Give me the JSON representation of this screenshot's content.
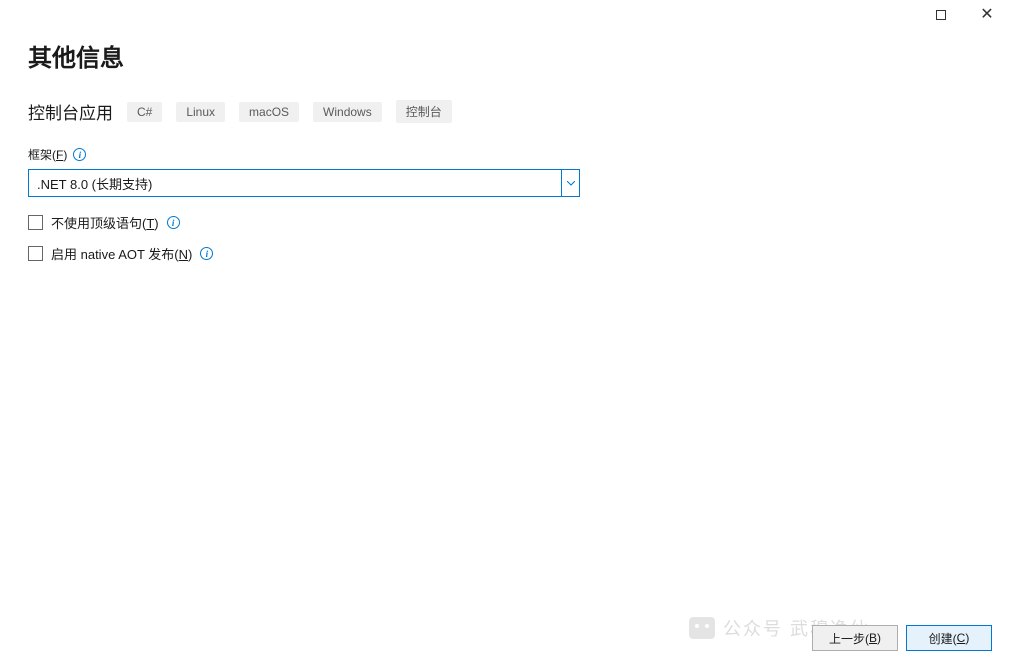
{
  "titlebar": {
    "maximize_name": "maximize",
    "close_name": "close"
  },
  "page": {
    "title": "其他信息",
    "subtitle": "控制台应用",
    "tags": [
      "C#",
      "Linux",
      "macOS",
      "Windows",
      "控制台"
    ]
  },
  "framework": {
    "label_prefix": "框架(",
    "label_hotkey": "F",
    "label_suffix": ")",
    "selected": ".NET 8.0 (长期支持)"
  },
  "options": {
    "top_level": {
      "label_prefix": "不使用顶级语句(",
      "label_hotkey": "T",
      "label_suffix": ")",
      "checked": false
    },
    "native_aot": {
      "label_prefix": "启用 native AOT 发布(",
      "label_hotkey": "N",
      "label_suffix": ")",
      "checked": false
    }
  },
  "footer": {
    "back_prefix": "上一步(",
    "back_hotkey": "B",
    "back_suffix": ")",
    "create_prefix": "创建(",
    "create_hotkey": "C",
    "create_suffix": ")"
  },
  "watermark": {
    "text": "公众号    武穆逸仙"
  }
}
